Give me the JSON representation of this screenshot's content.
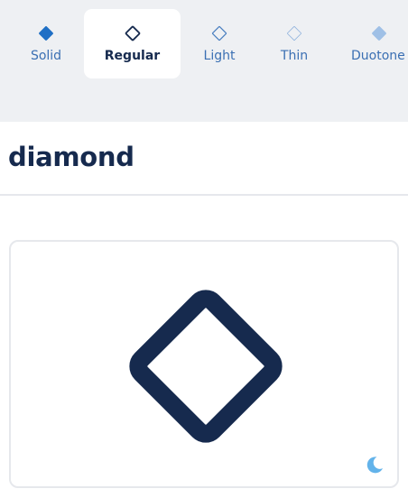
{
  "tabs": [
    {
      "label": "Solid",
      "icon": "diamond-solid-icon",
      "active": false
    },
    {
      "label": "Regular",
      "icon": "diamond-regular-icon",
      "active": true
    },
    {
      "label": "Light",
      "icon": "diamond-light-icon",
      "active": false
    },
    {
      "label": "Thin",
      "icon": "diamond-thin-icon",
      "active": false
    },
    {
      "label": "Duotone",
      "icon": "diamond-duotone-icon",
      "active": false
    }
  ],
  "icon_name": "diamond",
  "preview": {
    "icon": "diamond-regular-icon",
    "toggle_icon": "moon-icon"
  },
  "colors": {
    "navy": "#162a4e",
    "tab_blue": "#3a6fb3",
    "solid_blue": "#1f6fc5",
    "light_blue": "#4a7fc0",
    "thin_blue": "#8fb2dd",
    "duotone_blue": "#9fc0e6",
    "moon_blue": "#63b3ea",
    "tabbar_bg": "#eef0f3"
  }
}
